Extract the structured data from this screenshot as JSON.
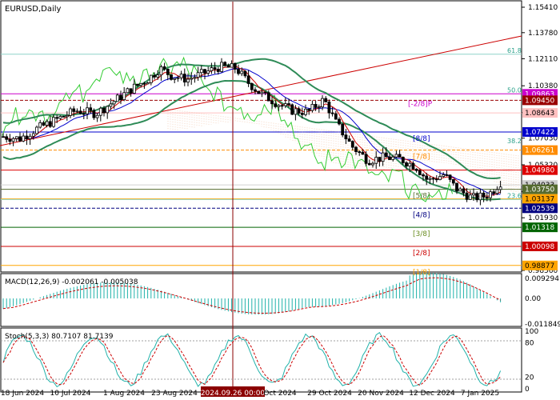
{
  "symbol_label": "EURUSD,Daily",
  "macd_label": "MACD(12,26,9) -0.002061 -0.005038",
  "stoch_label": "Stoch(5,3,3) 80.7107 81.7139",
  "x_labels": [
    "18 Jun 2024",
    "10 Jul 2024",
    "1 Aug 2024",
    "23 Aug 2024",
    "2024.09.26 00:00",
    "Oct 2024",
    "29 Oct 2024",
    "20 Nov 2024",
    "12 Dec 2024",
    "7 Jan 2025"
  ],
  "price_axis_ticks": [
    "1.15410",
    "1.13780",
    "1.12110",
    "1.10380",
    "1.08660",
    "1.07030",
    "1.05320",
    "1.03600",
    "1.01930",
    "0.98560"
  ],
  "price_level_tags": [
    {
      "text": "1.09863",
      "bg": "#cc00cc"
    },
    {
      "text": "1.09450",
      "bg": "#990000"
    },
    {
      "text": "1.08643",
      "bg": "#ffc0c0"
    },
    {
      "text": "1.07422",
      "bg": "#0000cc"
    },
    {
      "text": "1.06261",
      "bg": "#ff8c00"
    },
    {
      "text": "1.04980",
      "bg": "#dd0000"
    },
    {
      "text": "1.04033",
      "bg": "#d0d0d0"
    },
    {
      "text": "1.03750",
      "bg": "#556b2f"
    },
    {
      "text": "1.03137",
      "bg": "#ffa500"
    },
    {
      "text": "1.02539",
      "bg": "#000080"
    },
    {
      "text": "1.01318",
      "bg": "#006400"
    },
    {
      "text": "1.00098",
      "bg": "#cc0000"
    },
    {
      "text": "0.98877",
      "bg": "#ffa500"
    }
  ],
  "murray_labels": [
    {
      "text": "[-2/8]P",
      "color": "#cc00cc"
    },
    {
      "text": "[8/8]",
      "color": "#0000cc"
    },
    {
      "text": "[7/8]",
      "color": "#ff8c00"
    },
    {
      "text": "[5/8]",
      "color": "#556b2f"
    },
    {
      "text": "[4/8]",
      "color": "#000080"
    },
    {
      "text": "[3/8]",
      "color": "#6b8e23"
    },
    {
      "text": "[2/8]",
      "color": "#cc0000"
    },
    {
      "text": "[1/8]",
      "color": "#ffa500"
    }
  ],
  "fib_labels": [
    "61.8",
    "50.0",
    "38.2",
    "23.6"
  ],
  "macd_axis_ticks": [
    "0.009294",
    "0.00",
    "-0.011849"
  ],
  "stoch_axis_ticks": [
    "100",
    "80",
    "20",
    "0"
  ],
  "colors": {
    "bull_candle": "#000000",
    "bear_candle": "#000000",
    "bollinger": "#2e8b57",
    "ichimoku_chikou": "#33cc33",
    "ma_fast": "#cc0000",
    "ma_slow": "#0000cc",
    "macd_hist": "#20b2aa",
    "macd_signal": "#cc0000",
    "stoch_main": "#20b2aa",
    "stoch_signal": "#cc0000",
    "vertical_line": "#8b0000",
    "trendline": "#cc0000",
    "cloud": "#e8a070"
  },
  "chart_data": {
    "type": "line",
    "series": [
      {
        "name": "EURUSD",
        "x": [
          "18 Jun 2024",
          "10 Jul 2024",
          "1 Aug 2024",
          "23 Aug 2024",
          "26 Sep 2024",
          "Oct 2024",
          "29 Oct 2024",
          "20 Nov 2024",
          "12 Dec 2024",
          "7 Jan 2025"
        ],
        "values": [
          1.069,
          1.08,
          1.09,
          1.118,
          1.116,
          1.097,
          1.082,
          1.045,
          1.05,
          1.033
        ]
      }
    ],
    "ylim": [
      0.9856,
      1.1541
    ]
  }
}
